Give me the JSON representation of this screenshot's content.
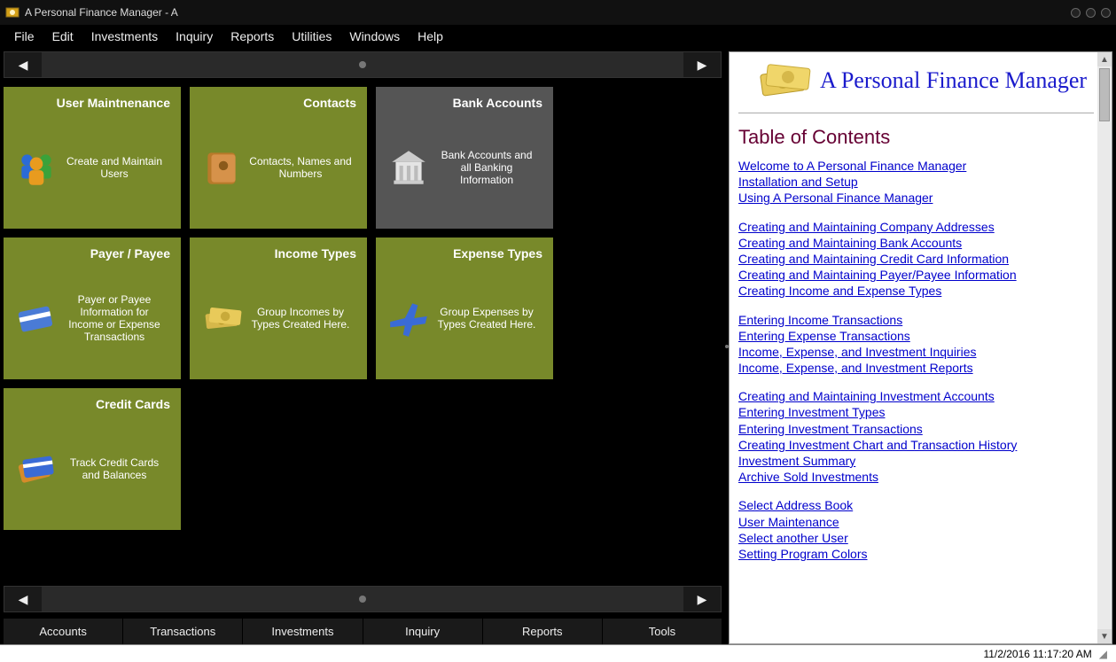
{
  "window": {
    "title": "A Personal Finance Manager - A"
  },
  "menubar": [
    "File",
    "Edit",
    "Investments",
    "Inquiry",
    "Reports",
    "Utilities",
    "Windows",
    "Help"
  ],
  "tiles": [
    {
      "title": "User Maintnenance",
      "desc": "Create and Maintain Users",
      "icon": "users",
      "active": true
    },
    {
      "title": "Contacts",
      "desc": "Contacts, Names and Numbers",
      "icon": "contacts",
      "active": true
    },
    {
      "title": "Bank Accounts",
      "desc": "Bank Accounts and all Banking Information",
      "icon": "bank",
      "active": false
    },
    {
      "title": "Payer / Payee",
      "desc": "Payer or Payee Information for Income or Expense Transactions",
      "icon": "card",
      "active": true
    },
    {
      "title": "Income Types",
      "desc": "Group Incomes by Types Created Here.",
      "icon": "money",
      "active": true
    },
    {
      "title": "Expense Types",
      "desc": "Group Expenses by Types Created Here.",
      "icon": "plane",
      "active": true
    },
    {
      "title": "Credit Cards",
      "desc": "Track Credit Cards and Balances",
      "icon": "creditcard",
      "active": true
    }
  ],
  "tabs": [
    "Accounts",
    "Transactions",
    "Investments",
    "Inquiry",
    "Reports",
    "Tools"
  ],
  "help": {
    "title": "A Personal Finance Manager",
    "toc_heading": "Table of Contents",
    "groups": [
      [
        "Welcome to A Personal Finance Manager",
        "Installation and Setup",
        "Using A Personal Finance Manager"
      ],
      [
        "Creating and Maintaining Company Addresses",
        "Creating and Maintaining Bank Accounts",
        "Creating and Maintaining Credit Card Information",
        "Creating and Maintaining Payer/Payee Information",
        "Creating Income and Expense Types"
      ],
      [
        "Entering Income Transactions",
        "Entering Expense Transactions",
        "Income, Expense, and Investment Inquiries",
        "Income, Expense, and Investment Reports"
      ],
      [
        "Creating and Maintaining Investment Accounts",
        "Entering Investment Types",
        "Entering Investment Transactions",
        "Creating Investment Chart and Transaction History",
        "Investment Summary",
        "Archive Sold Investments"
      ],
      [
        "Select Address Book",
        "User Maintenance",
        "Select another User",
        "Setting Program Colors"
      ]
    ]
  },
  "statusbar": {
    "datetime": "11/2/2016 11:17:20 AM"
  }
}
